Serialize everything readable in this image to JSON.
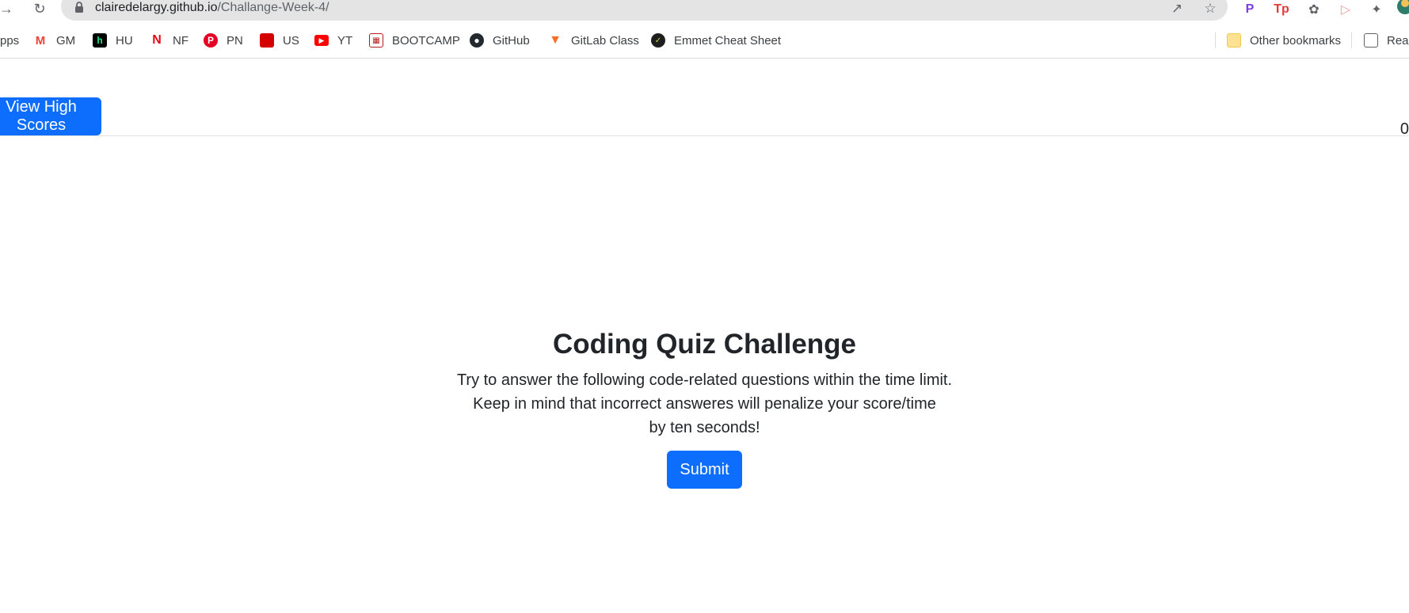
{
  "browser": {
    "url_host": "clairedelargy.github.io",
    "url_path": "/Challange-Week-4/",
    "bookmarks": [
      {
        "label": "pps",
        "icon": "apps-icon"
      },
      {
        "label": "GM",
        "icon": "gmail-icon",
        "color": "#ea4335"
      },
      {
        "label": "HU",
        "icon": "hulu-icon",
        "color": "#000000"
      },
      {
        "label": "NF",
        "icon": "netflix-icon",
        "color": "#e50914"
      },
      {
        "label": "PN",
        "icon": "pinterest-icon",
        "color": "#e60023"
      },
      {
        "label": "US",
        "icon": "us-icon",
        "color": "#d50000"
      },
      {
        "label": "YT",
        "icon": "youtube-icon",
        "color": "#ff0000"
      },
      {
        "label": "BOOTCAMP",
        "icon": "bootcamp-icon",
        "color": "#b71c1c"
      },
      {
        "label": "GitHub",
        "icon": "github-icon",
        "color": "#24292f"
      },
      {
        "label": "GitLab Class",
        "icon": "gitlab-icon",
        "color": "#fc6d26"
      },
      {
        "label": "Emmet Cheat Sheet",
        "icon": "emmet-icon",
        "color": "#1e1e1e"
      }
    ],
    "other_bookmarks": "Other bookmarks",
    "reading_list": "Read"
  },
  "page": {
    "high_scores_label": "View High Scores",
    "timer_value": "0",
    "title": "Coding Quiz Challenge",
    "description_lines": [
      "Try to answer the following code-related questions within the time limit.",
      "Keep in mind that incorrect answeres will penalize your score/time",
      "by ten seconds!"
    ],
    "submit_label": "Submit"
  },
  "colors": {
    "primary": "#0d6efd",
    "text": "#212529"
  }
}
